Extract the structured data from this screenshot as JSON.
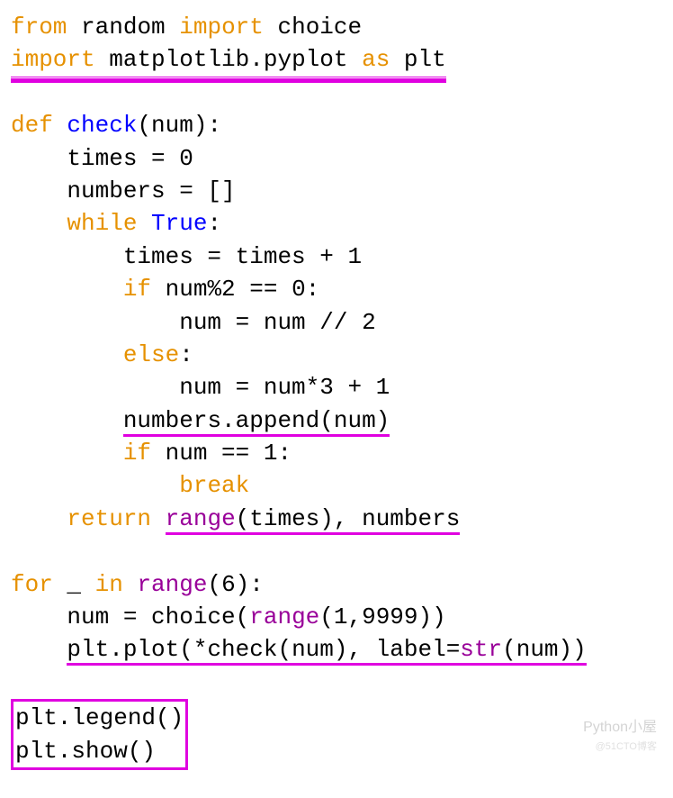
{
  "code": {
    "l1": {
      "from": "from",
      "random": "random",
      "import": "import",
      "choice": "choice"
    },
    "l2": {
      "import": "import",
      "mpl": "matplotlib.pyplot",
      "as": "as",
      "plt": "plt"
    },
    "l4": {
      "def": "def",
      "check": "check",
      "tail": "(num):"
    },
    "l5": "    times = 0",
    "l6": "    numbers = []",
    "l7": {
      "indent": "    ",
      "while": "while",
      "sp": " ",
      "true": "True",
      "colon": ":"
    },
    "l8": "        times = times + 1",
    "l9": {
      "indent": "        ",
      "if": "if",
      "cond": " num%2 == 0:"
    },
    "l10": "            num = num // 2",
    "l11": {
      "indent": "        ",
      "else": "else",
      "colon": ":"
    },
    "l12": "            num = num*3 + 1",
    "l13": {
      "indent": "        ",
      "call": "numbers.append(num)"
    },
    "l14": {
      "indent": "        ",
      "if": "if",
      "cond": " num == 1:"
    },
    "l15": {
      "indent": "            ",
      "break": "break"
    },
    "l16": {
      "indent": "    ",
      "return": "return",
      "sp": " ",
      "range": "range",
      "tail": "(times), numbers"
    },
    "l18": {
      "for": "for",
      "mid": " _ ",
      "in": "in",
      "sp": " ",
      "range": "range",
      "tail": "(6):"
    },
    "l19": {
      "indent": "    ",
      "lead": "num = choice(",
      "range": "range",
      "tail": "(1,9999))"
    },
    "l20": {
      "indent": "    ",
      "lead": "plt.plot(*check(num), label=",
      "str": "str",
      "tail": "(num))"
    },
    "l22": "plt.legend()",
    "l23": "plt.show()"
  },
  "watermark": {
    "line1": "Python小屋",
    "line2": "@51CTO博客"
  }
}
